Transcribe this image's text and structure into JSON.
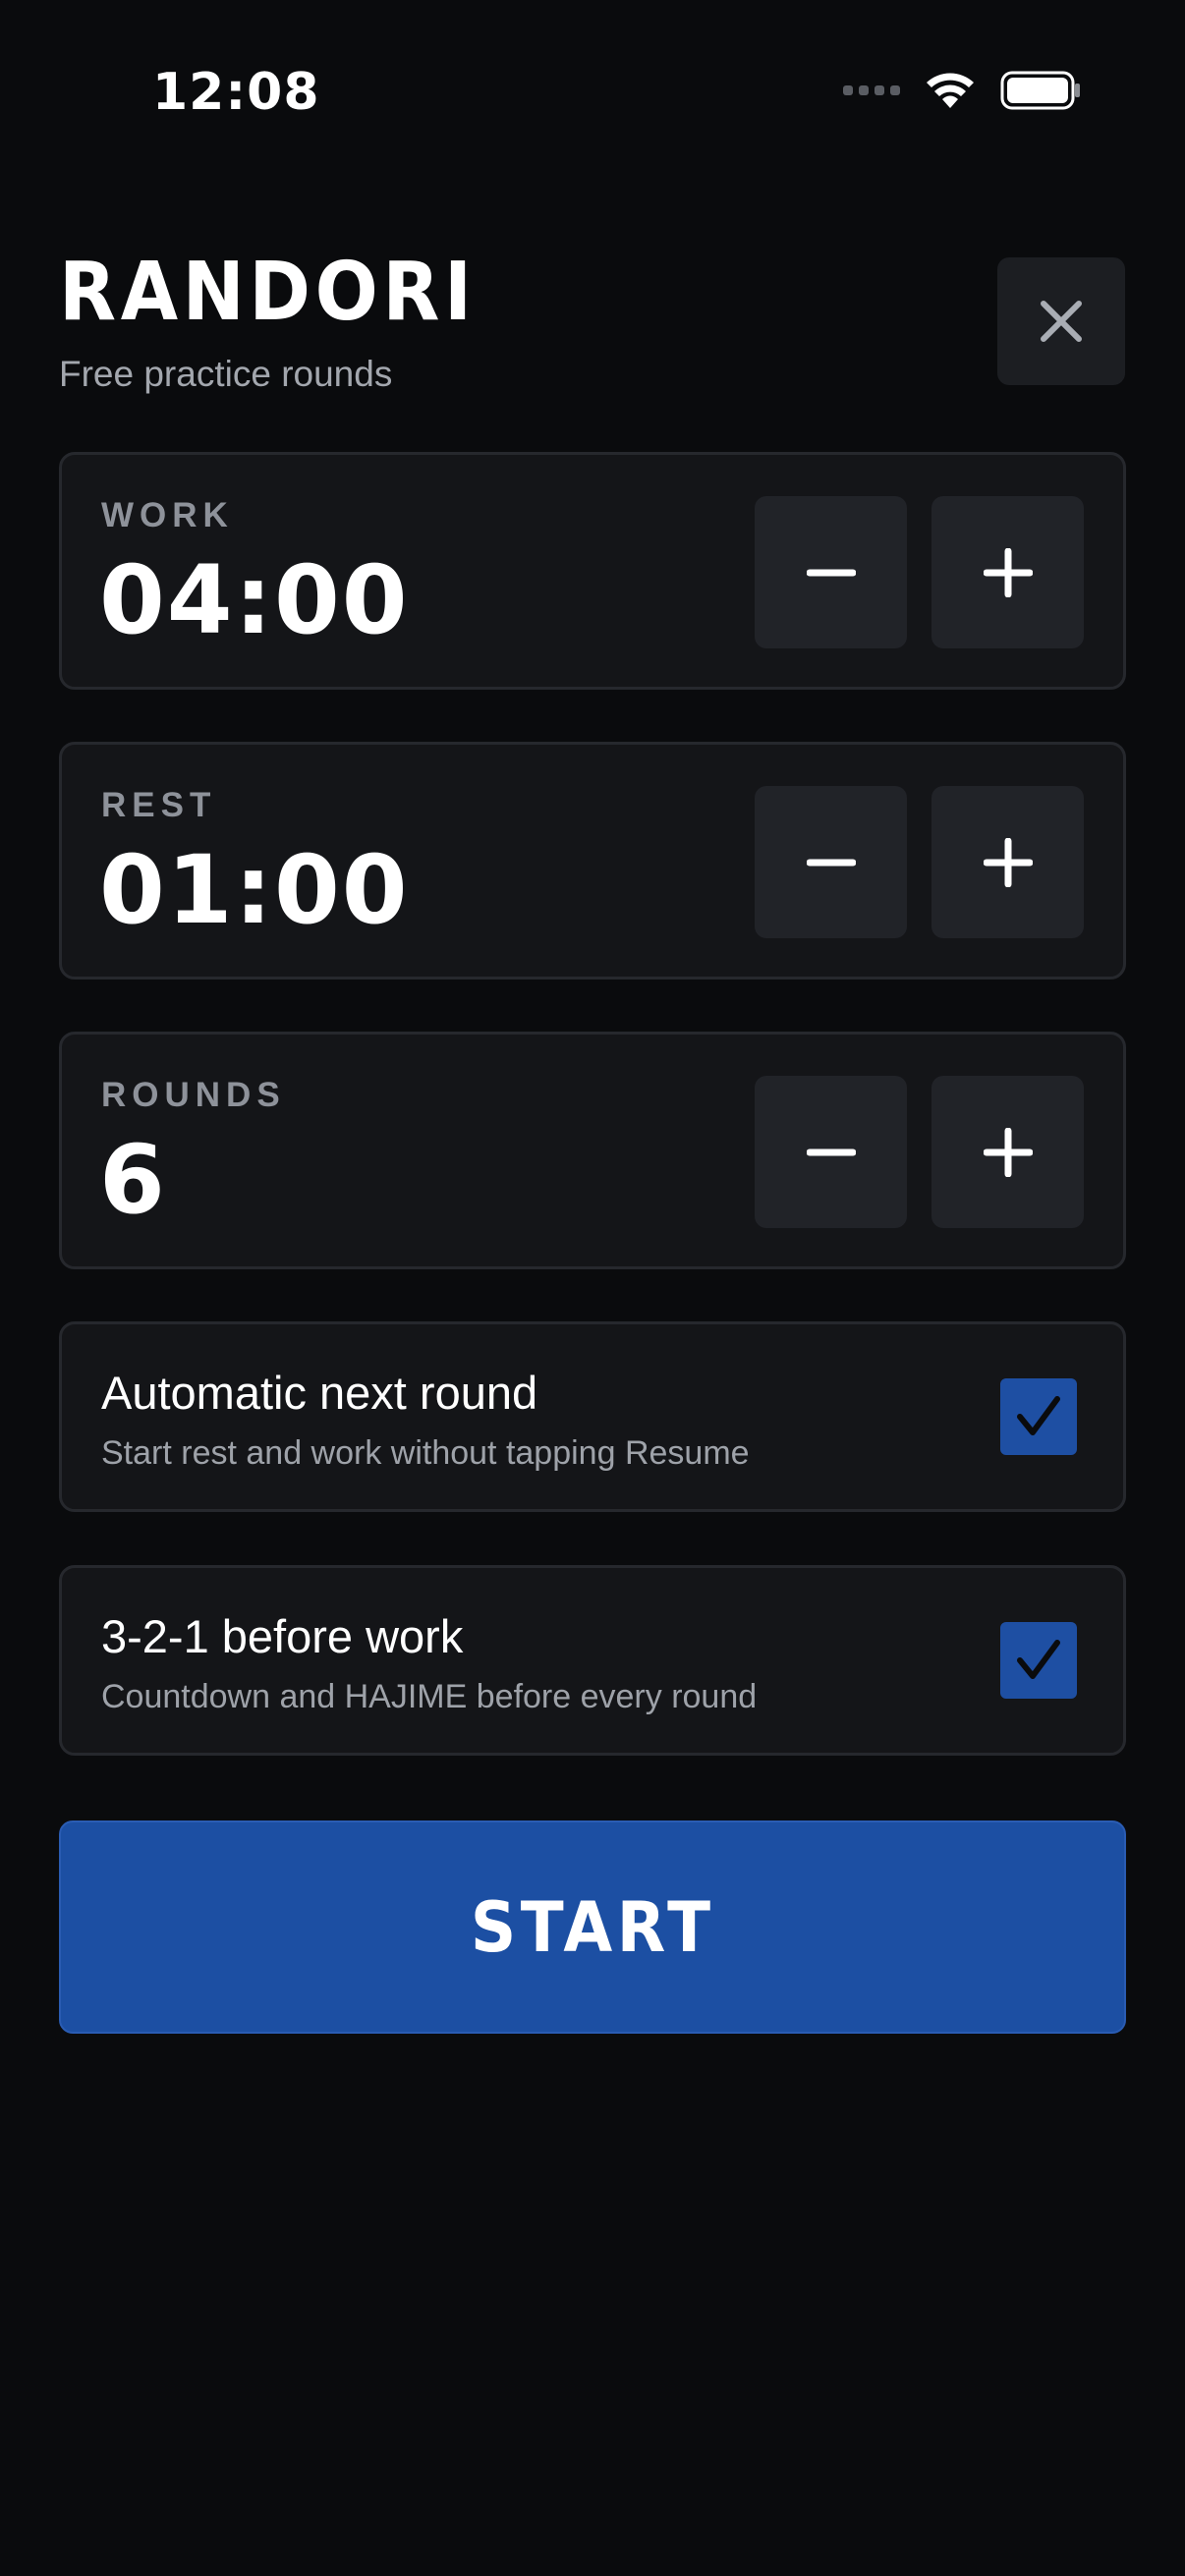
{
  "status_bar": {
    "time": "12:08"
  },
  "header": {
    "title": "RANDORI",
    "subtitle": "Free practice rounds"
  },
  "settings": {
    "work": {
      "label": "WORK",
      "value": "04:00"
    },
    "rest": {
      "label": "REST",
      "value": "01:00"
    },
    "rounds": {
      "label": "ROUNDS",
      "value": "6"
    }
  },
  "options": {
    "auto_next": {
      "title": "Automatic next round",
      "description": "Start rest and work without tapping Resume",
      "checked": true
    },
    "countdown": {
      "title": "3-2-1 before work",
      "description": "Countdown and HAJIME before every round",
      "checked": true
    }
  },
  "actions": {
    "start_label": "START"
  },
  "colors": {
    "background": "#0a0b0d",
    "card": "#141518",
    "accent": "#1c4fa3"
  }
}
